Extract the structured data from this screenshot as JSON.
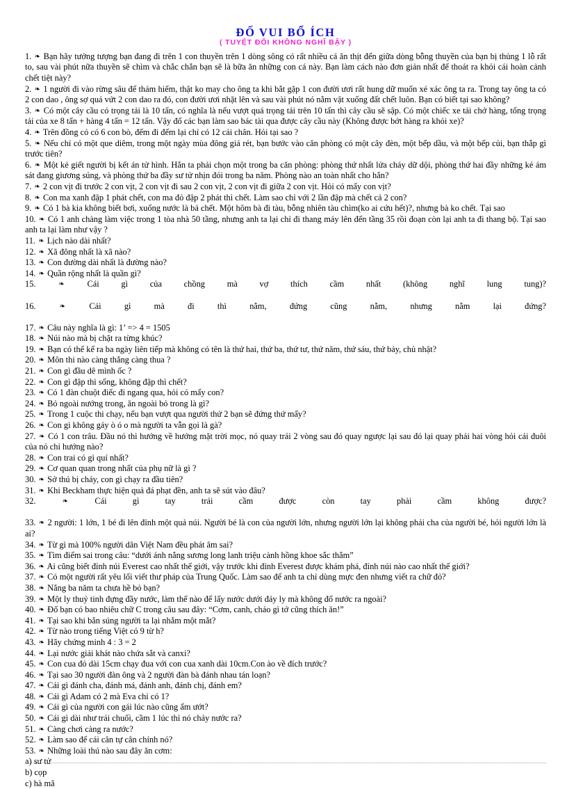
{
  "document": {
    "title": "ĐỐ VUI BỔ ÍCH",
    "subtitle": "( TUYỆT ĐỐI KHÔNG NGHĨ BẬY )",
    "title_color": "#1111cc",
    "subtitle_color": "#ee22cc",
    "bullet_glyph": "❧"
  },
  "questions": [
    {
      "num": "1.",
      "text": "Bạn hãy tưởng tượng bạn đang đi trên 1 con thuyền trên 1 dòng sông có rất nhiều cá ăn thịt đến giữa dòng bỗng thuyền của bạn bị thủng 1 lỗ rất to, sau vài phút nữa thuyền sẽ chìm và chắc chắn bạn sẽ là bữa ăn những con cá này. Bạn làm cách nào đơn giản nhất để thoát ra khỏi cái hoàn cảnh chết tiệt này?"
    },
    {
      "num": "2.",
      "text": "1 người đi vào rừng sâu để thám hiểm, thật ko may cho ông ta khi bắt gặp 1 con đười ươi rất hung dữ muốn xé xác ông ta ra. Trong tay ông ta có 2 con dao , ông sợ quá vứt 2 con dao ra đó, con đười ươi nhặt lên và sau vài phút nó nằm vật xuống đất chết luôn. Bạn có biết tại sao không?"
    },
    {
      "num": "3.",
      "text": "Có một cây cầu có trọng tải là 10 tấn, có nghĩa là nếu vượt quá trọng tải trên 10 tấn thì cây cầu sẽ sập. Có một chiếc xe tải chở hàng, tổng trọng tải của xe 8 tấn + hàng 4 tấn = 12 tấn. Vậy đố các bạn làm sao bác tài qua được cây cầu này (Không được bớt hàng ra khỏi xe)?"
    },
    {
      "num": "4.",
      "text": "Trên đồng cỏ có 6 con bò, đếm đi đếm lại chỉ có 12 cái chân. Hỏi tại sao ?"
    },
    {
      "num": "5.",
      "text": "Nếu chỉ có một que diêm, trong một ngày mùa đông giá rét, bạn bước vào căn phòng có một cây đèn, một bếp dầu, và một bếp củi, bạn thắp gì trước tiên?"
    },
    {
      "num": "6.",
      "text": "Một kẻ giết người bị kết án tử hình. Hắn ta phải chọn một trong ba căn phòng: phòng thứ nhất lửa cháy dữ dội, phòng thứ hai đầy những kẻ ám sát đang giương súng, và phòng thứ ba đầy sư tử nhịn đói trong ba năm. Phòng nào an toàn nhất cho hắn?"
    },
    {
      "num": "7.",
      "text": "2 con vịt đi trước 2 con vịt, 2 con vịt đi sau 2 con vịt, 2 con vịt đi giữa 2 con vịt. Hỏi có mấy con vịt?"
    },
    {
      "num": "8.",
      "text": "Con ma xanh đập 1 phát chết, con ma đỏ đập 2 phát thì chết. Làm sao chỉ với 2 lần đập mà chết cả 2 con?"
    },
    {
      "num": "9.",
      "text": "Có 1 bà kia không biết bơi, xuống nước là bả chết. Một hôm bà đi tàu, bỗng nhiên tàu chìm(ko ai cứu hết)?, nhưng bà ko chết. Tại sao"
    },
    {
      "num": "10.",
      "text": "Có 1 anh chàng làm việc trong 1 tòa nhà 50 tầng, nhưng anh ta lại chỉ đi thang máy lên đến tầng 35 rồi đoạn còn lại anh ta đi thang bộ. Tại sao anh ta lại làm như vậy ?"
    },
    {
      "num": "11.",
      "text": "Lịch nào dài nhất?"
    },
    {
      "num": "12.",
      "text": "Xã đông nhất là xã nào?"
    },
    {
      "num": "13.",
      "text": "Con đường dài nhất là đường nào?"
    },
    {
      "num": "14.",
      "text": "Quần rộng nhất là quần gì?"
    },
    {
      "num": "15.",
      "text": "Cái gì của chồng mà vợ thích cầm nhất (không nghĩ lung tung)?",
      "stretch": true
    },
    {
      "num": "16.",
      "text": "Cái gì mà đi thì nằm, đứng cũng nằm, nhưng nằm lại đứng?",
      "stretch": true
    },
    {
      "num": "17.",
      "text": "Câu này nghĩa là gì: 1’ => 4 = 1505"
    },
    {
      "num": "18.",
      "text": "Núi nào mà bị chặt ra từng khúc?"
    },
    {
      "num": "19.",
      "text": "Bạn có thể kể ra ba ngày liên tiếp mà không có tên là thứ hai, thứ ba, thứ tư, thứ năm, thứ sáu, thứ bảy, chủ nhật?"
    },
    {
      "num": "20.",
      "text": "Môn thi nào càng thắng càng thua ?"
    },
    {
      "num": "21.",
      "text": "Con gì đầu dê mình ốc ?"
    },
    {
      "num": "22.",
      "text": "Con gì đập thì sống, không đập thì chết?"
    },
    {
      "num": "23.",
      "text": "Có 1 đàn chuột điếc đi ngang qua, hỏi có mấy con?"
    },
    {
      "num": "24.",
      "text": "Bỏ ngoài nướng trong, ăn ngoài bỏ trong là gì?"
    },
    {
      "num": "25.",
      "text": "Trong 1 cuộc thi chạy, nếu bạn vượt qua người thứ 2 bạn sẽ đứng thứ mấy?"
    },
    {
      "num": "26.",
      "text": "Con gì không gáy ò ó o mà người ta vẫn gọi là gà?"
    },
    {
      "num": "27.",
      "text": "Có 1 con trâu. Đầu nó thì hướng về hướng mặt trời mọc, nó quay trái 2 vòng sau đó quay ngược lại sau đó lại quay phải hai vòng hỏi cái đuôi của nó chỉ hướng nào?"
    },
    {
      "num": "28.",
      "text": "Con trai có gì quí nhất?"
    },
    {
      "num": "29.",
      "text": "Cơ quan quan trong nhất của phụ nữ là gì ?"
    },
    {
      "num": "30.",
      "text": "Sở thú bị cháy, con gì chạy ra đầu tiên?"
    },
    {
      "num": "31.",
      "text": "Khi Beckham thực hiện quả đá phạt đền, anh ta sẽ sút vào đâu?"
    },
    {
      "num": "32.",
      "text": "Cái gì tay trái cầm được còn tay phải cầm không được?",
      "stretch": true
    },
    {
      "num": "33.",
      "text": "2 người: 1 lớn, 1 bé đi lên đỉnh một quả núi. Người bé là con của người lớn, nhưng người lớn lại không phải cha của người bé, hỏi người lớn là ai?"
    },
    {
      "num": "34.",
      "text": "Từ gì mà 100% người dân Việt Nam đều phát âm sai?"
    },
    {
      "num": "35.",
      "text": "Tìm điểm sai trong câu: “dưới ánh nắng sương long lanh triệu cành hồng khoe sắc thắm”"
    },
    {
      "num": "36.",
      "text": "Ai cũng biết đỉnh núi Everest cao nhất thế giới, vậy trước khi đỉnh Everest được khám phá, đỉnh núi nào cao nhất thế giới?"
    },
    {
      "num": "37.",
      "text": "Có một người rất yêu lối viết thư pháp của Trung Quốc. Làm sao để anh ta chỉ dùng mực đen nhưng viết ra chữ đỏ?"
    },
    {
      "num": "38.",
      "text": "Nắng ba năm ta chưa hề bỏ bạn?"
    },
    {
      "num": "39.",
      "text": "Một ly thuỷ tinh đựng đầy nước, làm thế nào để lấy nước dưới đáy ly mà không đổ nước ra ngoài?"
    },
    {
      "num": "40.",
      "text": "Đố bạn có bao nhiêu chữ C trong câu sau đây: “Cơm, canh, cháo gì tớ cũng thích ăn!”"
    },
    {
      "num": "41.",
      "text": "Tại sao khi bắn súng người ta lại nhắm một mắt?"
    },
    {
      "num": "42.",
      "text": "Từ nào trong tiếng Việt có 9 từ h?"
    },
    {
      "num": "43.",
      "text": "Hãy chứng minh 4 : 3 = 2"
    },
    {
      "num": "44.",
      "text": "Lại nước giải khát nào chứa sắt và canxi?"
    },
    {
      "num": "45.",
      "text": "Con cua đỏ dài 15cm chạy đua với con cua xanh dài 10cm.Con ào về đích trước?"
    },
    {
      "num": "46.",
      "text": "Tại sao 30 người đàn ông và 2 người đàn bà đánh nhau tán loạn?"
    },
    {
      "num": "47.",
      "text": "Cái gì đánh cha, đánh má, đánh anh, đánh chị, đánh em?"
    },
    {
      "num": "48.",
      "text": "Cái gì Adam có 2 mà Eva chỉ có 1?"
    },
    {
      "num": "49.",
      "text": "Cái gì của người con gái lúc nào cũng ẩm ướt?"
    },
    {
      "num": "50.",
      "text": "Cái gì dài như trái chuối, cầm 1 lúc thì nó chảy nước ra?"
    },
    {
      "num": "51.",
      "text": "Càng chơi càng ra nước?"
    },
    {
      "num": "52.",
      "text": "Làm sao để cái cân tự cân chính nó?"
    },
    {
      "num": "53.",
      "text": "Những loài thú nào sau đây ăn cơm:"
    }
  ],
  "options": [
    {
      "label": "a) sư tử"
    },
    {
      "label": "b) cọp"
    },
    {
      "label": "c) hà mã"
    }
  ]
}
